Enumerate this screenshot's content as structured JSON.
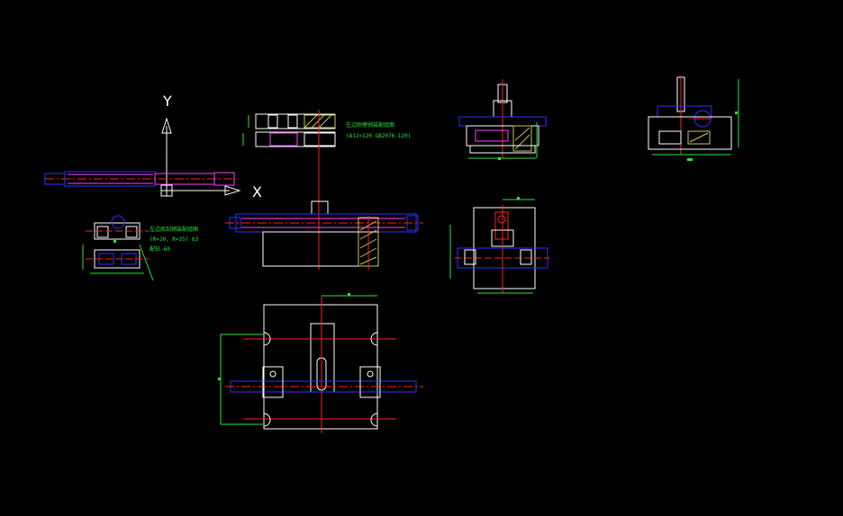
{
  "ucs": {
    "x_label": "X",
    "y_label": "Y"
  },
  "notes": {
    "upper_title": "左边刚擦销装配组图",
    "upper_spec": "(A12×120 GB2076-120)",
    "left_title": "左边底刮销装配组图",
    "left_line2": "(R=20, R=25) 63",
    "left_line3": "配钻-60"
  },
  "colors": {
    "background": "#000000",
    "outline": "#ffffff",
    "center": "#ff2020",
    "hidden": "#ff40ff",
    "blue": "#3030ff",
    "dimension": "#27e53a",
    "hatch": "#c8c850",
    "shaft": "#ff4040"
  }
}
